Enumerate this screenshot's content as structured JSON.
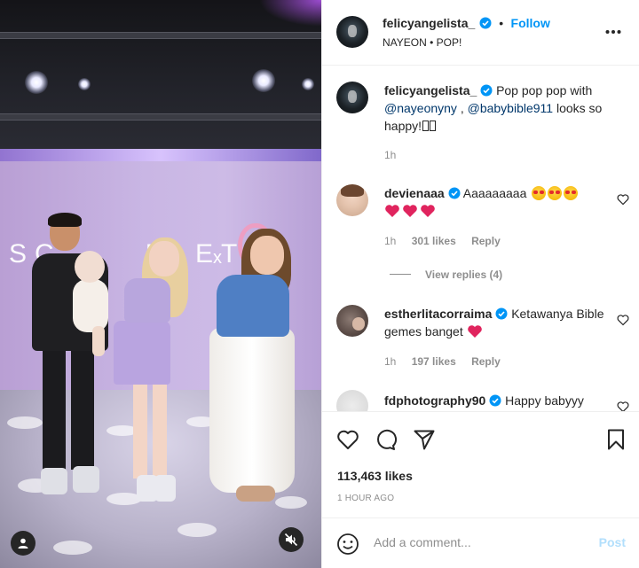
{
  "media": {
    "wall_text": "SC",
    "wall_text_rest": "RLET",
    "wall_separator": "x"
  },
  "post": {
    "username": "felicyangelista_",
    "follow_label": "Follow",
    "dot": "•",
    "audio": "NAYEON • POP!",
    "more_icon": "more-horizontal-icon"
  },
  "caption": {
    "username": "felicyangelista_",
    "text_before": "Pop pop pop with",
    "mention1": "@nayeonyny",
    "sep": ",",
    "mention2": "@babybible911",
    "text_after": "looks so happy!",
    "time": "1h"
  },
  "comments": [
    {
      "username": "devienaaa",
      "text": "Aaaaaaaaa",
      "time": "1h",
      "likes": "301 likes",
      "reply": "Reply",
      "view_replies": "View replies (4)"
    },
    {
      "username": "estherlitacorraima",
      "text": "Ketawanya Bible gemes banget",
      "time": "1h",
      "likes": "197 likes",
      "reply": "Reply"
    },
    {
      "username": "fdphotography90",
      "text": "Happy babyyy"
    }
  ],
  "actions": {
    "likes": "113,463 likes",
    "time_ago": "1 HOUR AGO"
  },
  "add_comment": {
    "placeholder": "Add a comment...",
    "post_label": "Post"
  },
  "colors": {
    "accent": "#0095f6",
    "mention": "#00376b",
    "secondary_text": "#8e8e8e"
  }
}
